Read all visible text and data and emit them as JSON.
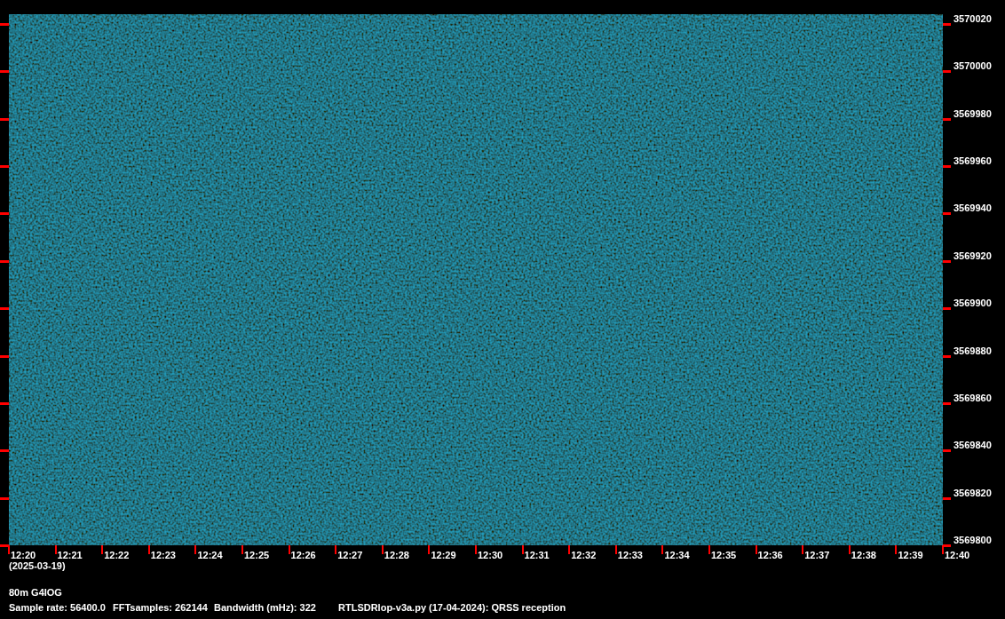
{
  "frequency_axis": {
    "labels": [
      "3570020",
      "3570000",
      "3569980",
      "3569960",
      "3569940",
      "3569920",
      "3569900",
      "3569880",
      "3569860",
      "3569840",
      "3569820",
      "3569800"
    ]
  },
  "time_axis": {
    "labels": [
      "12:20",
      "12:21",
      "12:22",
      "12:23",
      "12:24",
      "12:25",
      "12:26",
      "12:27",
      "12:28",
      "12:29",
      "12:30",
      "12:31",
      "12:32",
      "12:33",
      "12:34",
      "12:35",
      "12:36",
      "12:37",
      "12:38",
      "12:39",
      "12:40"
    ],
    "date": "(2025-03-19)"
  },
  "footer": {
    "title": "80m G4IOG",
    "info": [
      "Sample rate: 56400.0",
      "FFTsamples: 262144",
      "Bandwidth (mHz): 322",
      "RTLSDRlop-v3a.py (17-04-2024): QRSS reception"
    ]
  }
}
